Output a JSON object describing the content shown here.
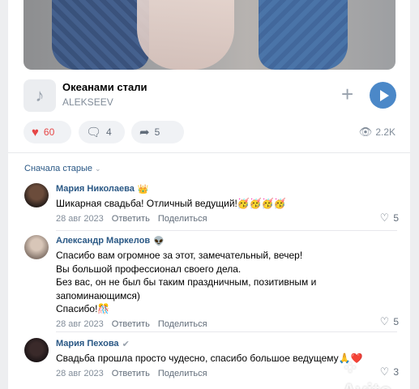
{
  "post": {
    "track": {
      "title": "Океанами стали",
      "artist": "ALEKSEEV",
      "icon": "music-note-icon",
      "add_icon": "plus-icon",
      "play_icon": "play-icon"
    },
    "likes": "60",
    "comments": "4",
    "shares": "5",
    "views": "2.2K",
    "colors": {
      "like": "#e64646",
      "link": "#2a5885",
      "play": "#4b88c8"
    }
  },
  "comments_sort": {
    "label": "Сначала старые"
  },
  "comments": [
    {
      "author": "Мария Николаева",
      "badge": "👑",
      "text_lines": [
        "Шикарная свадьба! Отличный ведущий!🥳🥳🥳🥳"
      ],
      "date": "28 авг 2023",
      "reply": "Ответить",
      "share": "Поделиться",
      "likes": "5"
    },
    {
      "author": "Александр Маркелов",
      "badge": "👽",
      "text_lines": [
        "Спасибо вам огромное за этот, замечательный, вечер!",
        "Вы большой профессионал своего дела.",
        "Без вас, он не был бы таким праздничным, позитивным и",
        "запоминающимся)",
        "Спасибо!🎊"
      ],
      "date": "28 авг 2023",
      "reply": "Ответить",
      "share": "Поделиться",
      "likes": "5"
    },
    {
      "author": "Мария Пехова",
      "badge": "✔",
      "text_lines": [
        "Свадьба прошла просто чудесно, спасибо большое ведущему🙏❤️"
      ],
      "date": "28 авг 2023",
      "reply": "Ответить",
      "share": "Поделиться",
      "likes": "3"
    }
  ],
  "watermark": "Avito"
}
